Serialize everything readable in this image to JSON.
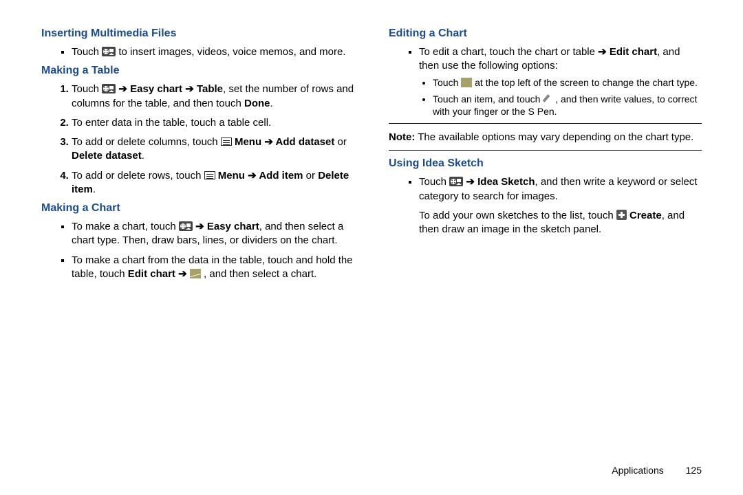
{
  "left": {
    "h1": "Inserting Multimedia Files",
    "b1": {
      "pre": "Touch ",
      "post": " to insert images, videos, voice memos, and more."
    },
    "h2": "Making a Table",
    "steps": [
      {
        "pre": "Touch ",
        "mid": " ",
        "chain": "Easy chart",
        "chain2": "Table",
        "post": ", set the number of rows and columns for the table, and then touch ",
        "done": "Done",
        "end": "."
      },
      {
        "text": "To enter data in the table, touch a table cell."
      },
      {
        "pre": "To add or delete columns, touch ",
        "menu": "Menu",
        "opts": "Add dataset",
        "or": " or ",
        "opts2": "Delete dataset",
        "end": "."
      },
      {
        "pre": "To add or delete rows, touch ",
        "menu": "Menu",
        "add": "Add item",
        "or": " or ",
        "del": "Delete item",
        "end": "."
      }
    ],
    "h3": "Making a Chart",
    "c1": {
      "pre": "To make a chart, touch ",
      "easy": "Easy chart",
      "post": ", and then select a chart type. Then, draw bars, lines, or dividers on the chart."
    },
    "c2": {
      "pre": "To make a chart from the data in the table, touch and hold the table, touch ",
      "edit": "Edit chart",
      "post": ", and then select a chart."
    }
  },
  "right": {
    "h1": "Editing a Chart",
    "e1": {
      "pre": "To edit a chart, touch the chart or table ",
      "edit": "Edit chart",
      "post": ", and then use the following options:"
    },
    "sub": [
      {
        "pre": "Touch ",
        "post": " at the top left of the screen to change the chart type."
      },
      {
        "pre": "Touch an item, and touch ",
        "post": ", and then write values, to correct with your finger or the S Pen."
      }
    ],
    "note_label": "Note:",
    "note": " The available options may vary depending on the chart type.",
    "h2": "Using Idea Sketch",
    "i1": {
      "pre": "Touch ",
      "idea": "Idea Sketch",
      "post": ", and then write a keyword or select category to search for images."
    },
    "i2": {
      "pre": "To add your own sketches to the list, touch ",
      "create": "Create",
      "post": ", and then draw an image in the sketch panel."
    }
  },
  "footer": {
    "section": "Applications",
    "page": "125"
  }
}
